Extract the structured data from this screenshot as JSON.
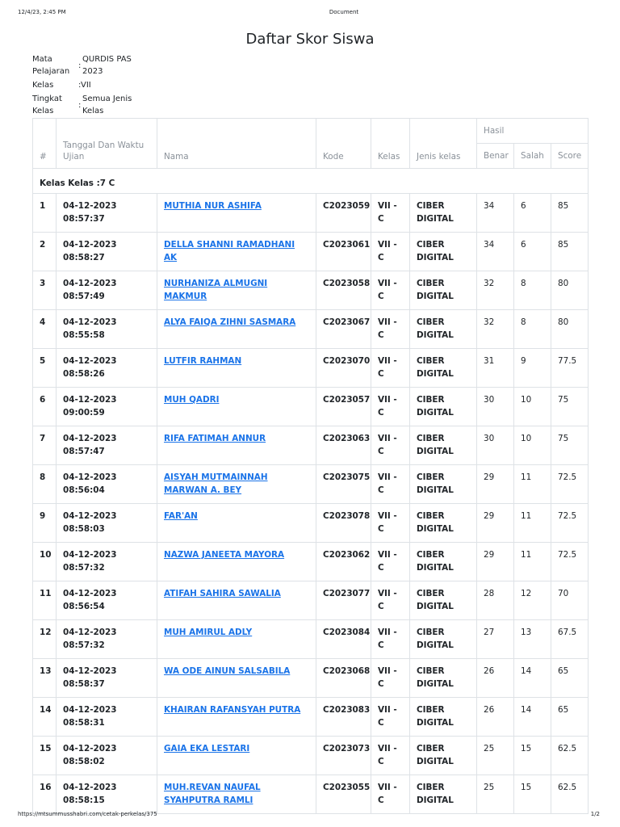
{
  "print": {
    "timestamp": "12/4/23, 2:45 PM",
    "doc_title": "Document",
    "url": "https://mtsummusshabri.com/cetak-perkelas/375",
    "page": "1/2"
  },
  "title": "Daftar Skor Siswa",
  "meta": [
    {
      "label1": "Mata",
      "label2": "Pelajaran",
      "colon": ":",
      "value1": "QURDIS PAS",
      "value2": "2023"
    },
    {
      "label1": "Kelas",
      "label2": "",
      "colon": ":",
      "value1": "VII",
      "value2": ""
    },
    {
      "label1": "Tingkat",
      "label2": "Kelas",
      "colon": ":",
      "value1": "Semua Jenis",
      "value2": "Kelas"
    }
  ],
  "table": {
    "headers": {
      "num": "#",
      "datetime1": "Tanggal Dan Waktu",
      "datetime2": "Ujian",
      "name": "Nama",
      "code": "Kode",
      "class": "Kelas",
      "class_type": "Jenis kelas",
      "result": "Hasil",
      "correct": "Benar",
      "wrong": "Salah",
      "score": "Score"
    },
    "group_label": "Kelas Kelas :7 C",
    "rows": [
      {
        "num": "1",
        "datetime": "04-12-2023 08:57:37",
        "name": "MUTHIA NUR ASHIFA",
        "code": "C2023059",
        "class1": "VII -",
        "class2": "C",
        "type1": "CIBER",
        "type2": "DIGITAL",
        "correct": "34",
        "wrong": "6",
        "score": "85"
      },
      {
        "num": "2",
        "datetime": "04-12-2023 08:58:27",
        "name": "DELLA SHANNI RAMADHANI AK",
        "code": "C2023061",
        "class1": "VII -",
        "class2": "C",
        "type1": "CIBER",
        "type2": "DIGITAL",
        "correct": "34",
        "wrong": "6",
        "score": "85"
      },
      {
        "num": "3",
        "datetime": "04-12-2023 08:57:49",
        "name": "NURHANIZA ALMUGNI MAKMUR",
        "code": "C2023058",
        "class1": "VII -",
        "class2": "C",
        "type1": "CIBER",
        "type2": "DIGITAL",
        "correct": "32",
        "wrong": "8",
        "score": "80"
      },
      {
        "num": "4",
        "datetime": "04-12-2023 08:55:58",
        "name": "ALYA FAIQA ZIHNI SASMARA",
        "code": "C2023067",
        "class1": "VII -",
        "class2": "C",
        "type1": "CIBER",
        "type2": "DIGITAL",
        "correct": "32",
        "wrong": "8",
        "score": "80"
      },
      {
        "num": "5",
        "datetime": "04-12-2023 08:58:26",
        "name": "LUTFIR RAHMAN",
        "code": "C2023070",
        "class1": "VII -",
        "class2": "C",
        "type1": "CIBER",
        "type2": "DIGITAL",
        "correct": "31",
        "wrong": "9",
        "score": "77.5"
      },
      {
        "num": "6",
        "datetime": "04-12-2023 09:00:59",
        "name": "MUH QADRI",
        "code": "C2023057",
        "class1": "VII -",
        "class2": "C",
        "type1": "CIBER",
        "type2": "DIGITAL",
        "correct": "30",
        "wrong": "10",
        "score": "75"
      },
      {
        "num": "7",
        "datetime": "04-12-2023 08:57:47",
        "name": "RIFA FATIMAH ANNUR",
        "code": "C2023063",
        "class1": "VII -",
        "class2": "C",
        "type1": "CIBER",
        "type2": "DIGITAL",
        "correct": "30",
        "wrong": "10",
        "score": "75"
      },
      {
        "num": "8",
        "datetime": "04-12-2023 08:56:04",
        "name": "AISYAH MUTMAINNAH MARWAN A. BEY",
        "code": "C2023075",
        "class1": "VII -",
        "class2": "C",
        "type1": "CIBER",
        "type2": "DIGITAL",
        "correct": "29",
        "wrong": "11",
        "score": "72.5"
      },
      {
        "num": "9",
        "datetime": "04-12-2023 08:58:03",
        "name": "FAR'AN",
        "code": "C2023078",
        "class1": "VII -",
        "class2": "C",
        "type1": "CIBER",
        "type2": "DIGITAL",
        "correct": "29",
        "wrong": "11",
        "score": "72.5"
      },
      {
        "num": "10",
        "datetime": "04-12-2023 08:57:32",
        "name": "NAZWA JANEETA MAYORA",
        "code": "C2023062",
        "class1": "VII -",
        "class2": "C",
        "type1": "CIBER",
        "type2": "DIGITAL",
        "correct": "29",
        "wrong": "11",
        "score": "72.5"
      },
      {
        "num": "11",
        "datetime": "04-12-2023 08:56:54",
        "name": "ATIFAH SAHIRA SAWALIA",
        "code": "C2023077",
        "class1": "VII -",
        "class2": "C",
        "type1": "CIBER",
        "type2": "DIGITAL",
        "correct": "28",
        "wrong": "12",
        "score": "70"
      },
      {
        "num": "12",
        "datetime": "04-12-2023 08:57:32",
        "name": "MUH AMIRUL ADLY",
        "code": "C2023084",
        "class1": "VII -",
        "class2": "C",
        "type1": "CIBER",
        "type2": "DIGITAL",
        "correct": "27",
        "wrong": "13",
        "score": "67.5"
      },
      {
        "num": "13",
        "datetime": "04-12-2023 08:58:37",
        "name": "WA ODE AINUN SALSABILA",
        "code": "C2023068",
        "class1": "VII -",
        "class2": "C",
        "type1": "CIBER",
        "type2": "DIGITAL",
        "correct": "26",
        "wrong": "14",
        "score": "65"
      },
      {
        "num": "14",
        "datetime": "04-12-2023 08:58:31",
        "name": "KHAIRAN RAFANSYAH PUTRA",
        "code": "C2023083",
        "class1": "VII -",
        "class2": "C",
        "type1": "CIBER",
        "type2": "DIGITAL",
        "correct": "26",
        "wrong": "14",
        "score": "65"
      },
      {
        "num": "15",
        "datetime": "04-12-2023 08:58:02",
        "name": "GAIA EKA LESTARI",
        "code": "C2023073",
        "class1": "VII -",
        "class2": "C",
        "type1": "CIBER",
        "type2": "DIGITAL",
        "correct": "25",
        "wrong": "15",
        "score": "62.5"
      },
      {
        "num": "16",
        "datetime": "04-12-2023 08:58:15",
        "name": "MUH.REVAN NAUFAL SYAHPUTRA RAMLI",
        "code": "C2023055",
        "class1": "VII -",
        "class2": "C",
        "type1": "CIBER",
        "type2": "DIGITAL",
        "correct": "25",
        "wrong": "15",
        "score": "62.5"
      }
    ]
  },
  "colors": {
    "link": "#1a73e8",
    "border": "#dee2e6",
    "header_text": "#8a9199"
  }
}
